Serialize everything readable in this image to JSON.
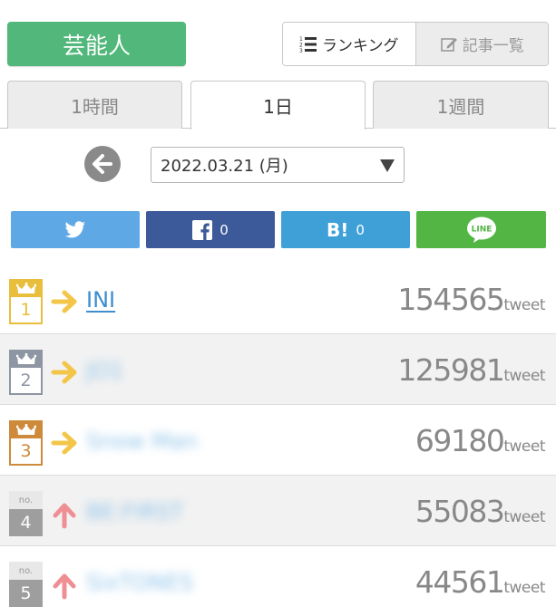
{
  "header": {
    "category": "芸能人",
    "view_ranking": "ランキング",
    "view_articles": "記事一覧"
  },
  "tabs": [
    {
      "label": "1時間",
      "active": false
    },
    {
      "label": "1日",
      "active": true
    },
    {
      "label": "1週間",
      "active": false
    }
  ],
  "date": {
    "selected": "2022.03.21 (月)"
  },
  "share": {
    "facebook_count": "0",
    "hatena_label": "B!",
    "hatena_count": "0",
    "line_label": "LINE"
  },
  "colors": {
    "gold": "#e8be3c",
    "silver": "#8e96a3",
    "bronze": "#cd8a3a",
    "arrow_same": "#f3c64a",
    "arrow_up": "#ef8f94"
  },
  "rankings": [
    {
      "rank": "1",
      "name": "INI",
      "count": "154565",
      "unit": "tweet",
      "trend": "same",
      "medal": "gold",
      "blurred": false
    },
    {
      "rank": "2",
      "name": "JO1",
      "count": "125981",
      "unit": "tweet",
      "trend": "same",
      "medal": "silver",
      "blurred": true
    },
    {
      "rank": "3",
      "name": "Snow Man",
      "count": "69180",
      "unit": "tweet",
      "trend": "same",
      "medal": "bronze",
      "blurred": true
    },
    {
      "rank": "4",
      "name": "BE:FIRST",
      "count": "55083",
      "unit": "tweet",
      "trend": "up",
      "medal": "none",
      "no_label": "no.",
      "blurred": true
    },
    {
      "rank": "5",
      "name": "SixTONES",
      "count": "44561",
      "unit": "tweet",
      "trend": "up",
      "medal": "none",
      "no_label": "no.",
      "blurred": true
    }
  ]
}
